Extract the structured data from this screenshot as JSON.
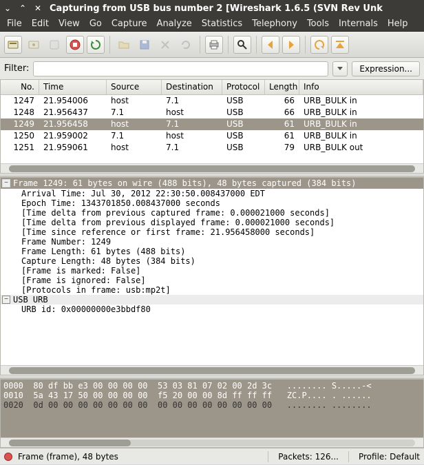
{
  "window": {
    "title": "Capturing from USB bus number 2    [Wireshark 1.6.5  (SVN Rev Unk"
  },
  "menu": [
    "File",
    "Edit",
    "View",
    "Go",
    "Capture",
    "Analyze",
    "Statistics",
    "Telephony",
    "Tools",
    "Internals",
    "Help"
  ],
  "toolbar": {
    "icons": [
      {
        "name": "interfaces-icon",
        "enabled": true
      },
      {
        "name": "options-icon",
        "enabled": false
      },
      {
        "name": "start-icon",
        "enabled": false
      },
      {
        "name": "stop-icon",
        "enabled": true
      },
      {
        "name": "restart-icon",
        "enabled": true
      },
      {
        "sep": true
      },
      {
        "name": "open-icon",
        "enabled": false
      },
      {
        "name": "save-icon",
        "enabled": false
      },
      {
        "name": "close-icon",
        "enabled": false
      },
      {
        "name": "reload-icon",
        "enabled": false
      },
      {
        "sep": true
      },
      {
        "name": "print-icon",
        "enabled": true
      },
      {
        "sep": true
      },
      {
        "name": "find-icon",
        "enabled": true
      },
      {
        "sep": true
      },
      {
        "name": "back-icon",
        "enabled": true
      },
      {
        "name": "forward-icon",
        "enabled": true
      },
      {
        "sep": true
      },
      {
        "name": "jump-icon",
        "enabled": true
      },
      {
        "name": "top-icon",
        "enabled": true
      }
    ]
  },
  "filter": {
    "label": "Filter:",
    "value": "",
    "expression": "Expression..."
  },
  "packetlist": {
    "columns": [
      "No.",
      "Time",
      "Source",
      "Destination",
      "Protocol",
      "Length",
      "Info"
    ],
    "rows": [
      {
        "no": "1247",
        "time": "21.954006",
        "src": "host",
        "dst": "7.1",
        "proto": "USB",
        "len": "66",
        "info": "URB_BULK in"
      },
      {
        "no": "1248",
        "time": "21.956437",
        "src": "7.1",
        "dst": "host",
        "proto": "USB",
        "len": "66",
        "info": "URB_BULK in"
      },
      {
        "no": "1249",
        "time": "21.956458",
        "src": "host",
        "dst": "7.1",
        "proto": "USB",
        "len": "61",
        "info": "URB_BULK in",
        "selected": true
      },
      {
        "no": "1250",
        "time": "21.959002",
        "src": "7.1",
        "dst": "host",
        "proto": "USB",
        "len": "61",
        "info": "URB_BULK in"
      },
      {
        "no": "1251",
        "time": "21.959061",
        "src": "host",
        "dst": "7.1",
        "proto": "USB",
        "len": "79",
        "info": "URB_BULK out"
      }
    ]
  },
  "details": {
    "frame_header": "Frame 1249: 61 bytes on wire (488 bits), 48 bytes captured (384 bits)",
    "lines": [
      "Arrival Time: Jul 30, 2012 22:30:50.008437000 EDT",
      "Epoch Time: 1343701850.008437000 seconds",
      "[Time delta from previous captured frame: 0.000021000 seconds]",
      "[Time delta from previous displayed frame: 0.000021000 seconds]",
      "[Time since reference or first frame: 21.956458000 seconds]",
      "Frame Number: 1249",
      "Frame Length: 61 bytes (488 bits)",
      "Capture Length: 48 bytes (384 bits)",
      "[Frame is marked: False]",
      "[Frame is ignored: False]",
      "[Protocols in frame: usb:mp2t]"
    ],
    "usb_header": "USB URB",
    "usb_line": "URB id: 0x00000000e3bbdf80"
  },
  "hex": {
    "lines": [
      {
        "off": "0000",
        "hex": "80 df bb e3 00 00 00 00  53 03 81 07 02 00 2d 3c",
        "asc": "........ S.....-<"
      },
      {
        "off": "0010",
        "hex": "5a 43 17 50 00 00 00 00  f5 20 00 00 8d ff ff ff",
        "asc": "ZC.P.... . ......"
      },
      {
        "off": "0020",
        "hex": "0d 00 00 00 00 00 00 00  00 00 00 00 00 00 00 00",
        "asc": "........ ........"
      }
    ]
  },
  "status": {
    "frame": "Frame (frame), 48 bytes",
    "packets": "Packets: 126...",
    "profile": "Profile: Default"
  }
}
